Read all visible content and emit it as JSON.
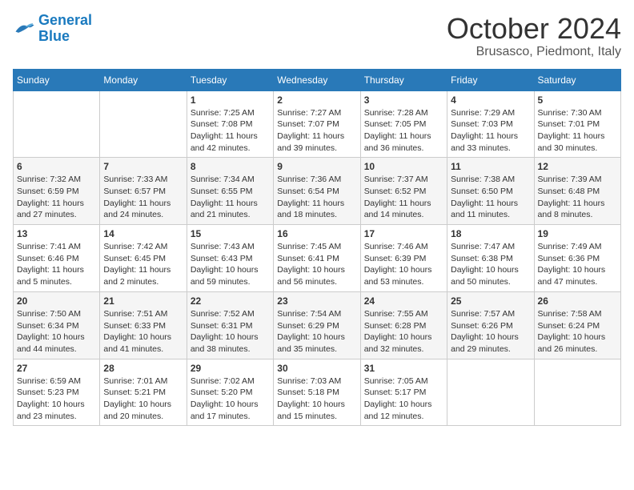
{
  "header": {
    "logo_line1": "General",
    "logo_line2": "Blue",
    "month": "October 2024",
    "location": "Brusasco, Piedmont, Italy"
  },
  "weekdays": [
    "Sunday",
    "Monday",
    "Tuesday",
    "Wednesday",
    "Thursday",
    "Friday",
    "Saturday"
  ],
  "weeks": [
    [
      {
        "day": "",
        "sunrise": "",
        "sunset": "",
        "daylight": ""
      },
      {
        "day": "",
        "sunrise": "",
        "sunset": "",
        "daylight": ""
      },
      {
        "day": "1",
        "sunrise": "Sunrise: 7:25 AM",
        "sunset": "Sunset: 7:08 PM",
        "daylight": "Daylight: 11 hours and 42 minutes."
      },
      {
        "day": "2",
        "sunrise": "Sunrise: 7:27 AM",
        "sunset": "Sunset: 7:07 PM",
        "daylight": "Daylight: 11 hours and 39 minutes."
      },
      {
        "day": "3",
        "sunrise": "Sunrise: 7:28 AM",
        "sunset": "Sunset: 7:05 PM",
        "daylight": "Daylight: 11 hours and 36 minutes."
      },
      {
        "day": "4",
        "sunrise": "Sunrise: 7:29 AM",
        "sunset": "Sunset: 7:03 PM",
        "daylight": "Daylight: 11 hours and 33 minutes."
      },
      {
        "day": "5",
        "sunrise": "Sunrise: 7:30 AM",
        "sunset": "Sunset: 7:01 PM",
        "daylight": "Daylight: 11 hours and 30 minutes."
      }
    ],
    [
      {
        "day": "6",
        "sunrise": "Sunrise: 7:32 AM",
        "sunset": "Sunset: 6:59 PM",
        "daylight": "Daylight: 11 hours and 27 minutes."
      },
      {
        "day": "7",
        "sunrise": "Sunrise: 7:33 AM",
        "sunset": "Sunset: 6:57 PM",
        "daylight": "Daylight: 11 hours and 24 minutes."
      },
      {
        "day": "8",
        "sunrise": "Sunrise: 7:34 AM",
        "sunset": "Sunset: 6:55 PM",
        "daylight": "Daylight: 11 hours and 21 minutes."
      },
      {
        "day": "9",
        "sunrise": "Sunrise: 7:36 AM",
        "sunset": "Sunset: 6:54 PM",
        "daylight": "Daylight: 11 hours and 18 minutes."
      },
      {
        "day": "10",
        "sunrise": "Sunrise: 7:37 AM",
        "sunset": "Sunset: 6:52 PM",
        "daylight": "Daylight: 11 hours and 14 minutes."
      },
      {
        "day": "11",
        "sunrise": "Sunrise: 7:38 AM",
        "sunset": "Sunset: 6:50 PM",
        "daylight": "Daylight: 11 hours and 11 minutes."
      },
      {
        "day": "12",
        "sunrise": "Sunrise: 7:39 AM",
        "sunset": "Sunset: 6:48 PM",
        "daylight": "Daylight: 11 hours and 8 minutes."
      }
    ],
    [
      {
        "day": "13",
        "sunrise": "Sunrise: 7:41 AM",
        "sunset": "Sunset: 6:46 PM",
        "daylight": "Daylight: 11 hours and 5 minutes."
      },
      {
        "day": "14",
        "sunrise": "Sunrise: 7:42 AM",
        "sunset": "Sunset: 6:45 PM",
        "daylight": "Daylight: 11 hours and 2 minutes."
      },
      {
        "day": "15",
        "sunrise": "Sunrise: 7:43 AM",
        "sunset": "Sunset: 6:43 PM",
        "daylight": "Daylight: 10 hours and 59 minutes."
      },
      {
        "day": "16",
        "sunrise": "Sunrise: 7:45 AM",
        "sunset": "Sunset: 6:41 PM",
        "daylight": "Daylight: 10 hours and 56 minutes."
      },
      {
        "day": "17",
        "sunrise": "Sunrise: 7:46 AM",
        "sunset": "Sunset: 6:39 PM",
        "daylight": "Daylight: 10 hours and 53 minutes."
      },
      {
        "day": "18",
        "sunrise": "Sunrise: 7:47 AM",
        "sunset": "Sunset: 6:38 PM",
        "daylight": "Daylight: 10 hours and 50 minutes."
      },
      {
        "day": "19",
        "sunrise": "Sunrise: 7:49 AM",
        "sunset": "Sunset: 6:36 PM",
        "daylight": "Daylight: 10 hours and 47 minutes."
      }
    ],
    [
      {
        "day": "20",
        "sunrise": "Sunrise: 7:50 AM",
        "sunset": "Sunset: 6:34 PM",
        "daylight": "Daylight: 10 hours and 44 minutes."
      },
      {
        "day": "21",
        "sunrise": "Sunrise: 7:51 AM",
        "sunset": "Sunset: 6:33 PM",
        "daylight": "Daylight: 10 hours and 41 minutes."
      },
      {
        "day": "22",
        "sunrise": "Sunrise: 7:52 AM",
        "sunset": "Sunset: 6:31 PM",
        "daylight": "Daylight: 10 hours and 38 minutes."
      },
      {
        "day": "23",
        "sunrise": "Sunrise: 7:54 AM",
        "sunset": "Sunset: 6:29 PM",
        "daylight": "Daylight: 10 hours and 35 minutes."
      },
      {
        "day": "24",
        "sunrise": "Sunrise: 7:55 AM",
        "sunset": "Sunset: 6:28 PM",
        "daylight": "Daylight: 10 hours and 32 minutes."
      },
      {
        "day": "25",
        "sunrise": "Sunrise: 7:57 AM",
        "sunset": "Sunset: 6:26 PM",
        "daylight": "Daylight: 10 hours and 29 minutes."
      },
      {
        "day": "26",
        "sunrise": "Sunrise: 7:58 AM",
        "sunset": "Sunset: 6:24 PM",
        "daylight": "Daylight: 10 hours and 26 minutes."
      }
    ],
    [
      {
        "day": "27",
        "sunrise": "Sunrise: 6:59 AM",
        "sunset": "Sunset: 5:23 PM",
        "daylight": "Daylight: 10 hours and 23 minutes."
      },
      {
        "day": "28",
        "sunrise": "Sunrise: 7:01 AM",
        "sunset": "Sunset: 5:21 PM",
        "daylight": "Daylight: 10 hours and 20 minutes."
      },
      {
        "day": "29",
        "sunrise": "Sunrise: 7:02 AM",
        "sunset": "Sunset: 5:20 PM",
        "daylight": "Daylight: 10 hours and 17 minutes."
      },
      {
        "day": "30",
        "sunrise": "Sunrise: 7:03 AM",
        "sunset": "Sunset: 5:18 PM",
        "daylight": "Daylight: 10 hours and 15 minutes."
      },
      {
        "day": "31",
        "sunrise": "Sunrise: 7:05 AM",
        "sunset": "Sunset: 5:17 PM",
        "daylight": "Daylight: 10 hours and 12 minutes."
      },
      {
        "day": "",
        "sunrise": "",
        "sunset": "",
        "daylight": ""
      },
      {
        "day": "",
        "sunrise": "",
        "sunset": "",
        "daylight": ""
      }
    ]
  ]
}
